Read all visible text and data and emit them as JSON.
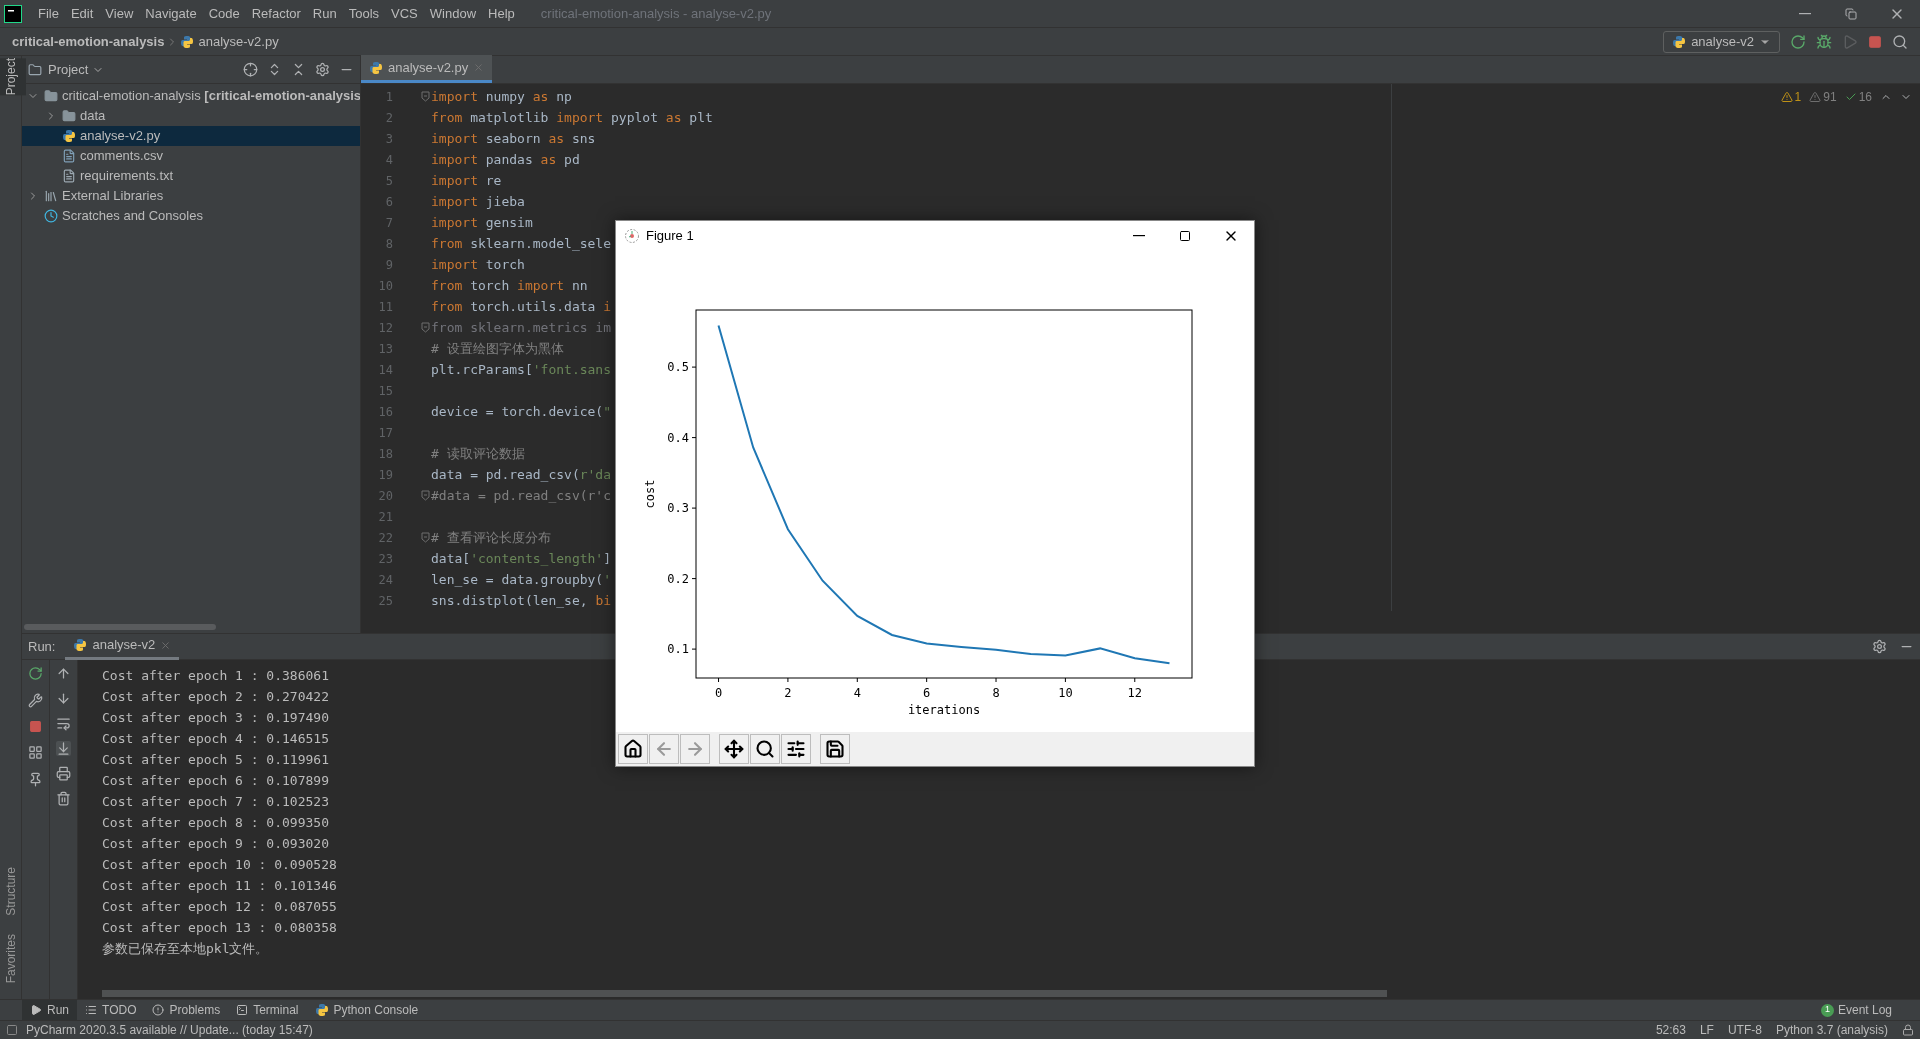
{
  "menu_bar": {
    "items": [
      "File",
      "Edit",
      "View",
      "Navigate",
      "Code",
      "Refactor",
      "Run",
      "Tools",
      "VCS",
      "Window",
      "Help"
    ],
    "title": "critical-emotion-analysis - analyse-v2.py"
  },
  "nav_bar": {
    "breadcrumbs": [
      "critical-emotion-analysis",
      "analyse-v2.py"
    ],
    "run_config": "analyse-v2"
  },
  "side_strip": {
    "top": [
      {
        "label": "Project",
        "selected": true
      }
    ],
    "bottom": [
      {
        "label": "Structure",
        "selected": false
      },
      {
        "label": "Favorites",
        "selected": false
      }
    ]
  },
  "project_panel": {
    "title": "Project",
    "tree": [
      {
        "label": "critical-emotion-analysis **[critical-emotion-analysis**",
        "kind": "folder",
        "expanded": true,
        "selected": false,
        "children": [
          {
            "label": "data",
            "kind": "folder",
            "expanded": false,
            "selected": false
          },
          {
            "label": "analyse-v2.py",
            "kind": "python",
            "selected": true
          },
          {
            "label": "comments.csv",
            "kind": "csv",
            "selected": false
          },
          {
            "label": "requirements.txt",
            "kind": "text",
            "selected": false
          }
        ]
      },
      {
        "label": "External Libraries",
        "kind": "library",
        "expanded": false,
        "selected": false
      },
      {
        "label": "Scratches and Consoles",
        "kind": "scratches",
        "selected": false
      }
    ]
  },
  "editor": {
    "tabs": [
      {
        "label": "analyse-v2.py",
        "selected": true
      }
    ],
    "inspections": [
      {
        "kind": "warning",
        "count": "1"
      },
      {
        "kind": "weak",
        "count": "91"
      },
      {
        "kind": "typo",
        "count": "16"
      }
    ],
    "lines": [
      {
        "number": "1",
        "fold": true,
        "tokens": [
          {
            "t": "import",
            "kind": "keyword"
          },
          {
            "t": " numpy ",
            "kind": "plain"
          },
          {
            "t": "as",
            "kind": "keyword"
          },
          {
            "t": " np",
            "kind": "plain"
          }
        ]
      },
      {
        "number": "2",
        "fold": false,
        "tokens": [
          {
            "t": "from",
            "kind": "keyword"
          },
          {
            "t": " matplotlib ",
            "kind": "plain"
          },
          {
            "t": "import",
            "kind": "keyword"
          },
          {
            "t": " pyplot ",
            "kind": "plain"
          },
          {
            "t": "as",
            "kind": "keyword"
          },
          {
            "t": " plt",
            "kind": "plain"
          }
        ]
      },
      {
        "number": "3",
        "fold": false,
        "tokens": [
          {
            "t": "import",
            "kind": "keyword"
          },
          {
            "t": " seaborn ",
            "kind": "plain"
          },
          {
            "t": "as",
            "kind": "keyword"
          },
          {
            "t": " sns",
            "kind": "plain"
          }
        ]
      },
      {
        "number": "4",
        "fold": false,
        "tokens": [
          {
            "t": "import",
            "kind": "keyword"
          },
          {
            "t": " pandas ",
            "kind": "plain"
          },
          {
            "t": "as",
            "kind": "keyword"
          },
          {
            "t": " pd",
            "kind": "plain"
          }
        ]
      },
      {
        "number": "5",
        "fold": false,
        "tokens": [
          {
            "t": "import",
            "kind": "keyword"
          },
          {
            "t": " re",
            "kind": "plain"
          }
        ]
      },
      {
        "number": "6",
        "fold": false,
        "tokens": [
          {
            "t": "import",
            "kind": "keyword"
          },
          {
            "t": " jieba",
            "kind": "plain"
          }
        ]
      },
      {
        "number": "7",
        "fold": false,
        "tokens": [
          {
            "t": "import",
            "kind": "keyword"
          },
          {
            "t": " gensim",
            "kind": "plain"
          }
        ]
      },
      {
        "number": "8",
        "fold": false,
        "tokens": [
          {
            "t": "from",
            "kind": "keyword"
          },
          {
            "t": " sklearn.model_sele",
            "kind": "plain"
          }
        ]
      },
      {
        "number": "9",
        "fold": false,
        "tokens": [
          {
            "t": "import",
            "kind": "keyword"
          },
          {
            "t": " torch",
            "kind": "plain"
          }
        ]
      },
      {
        "number": "10",
        "fold": false,
        "tokens": [
          {
            "t": "from",
            "kind": "keyword"
          },
          {
            "t": " torch ",
            "kind": "plain"
          },
          {
            "t": "import",
            "kind": "keyword"
          },
          {
            "t": " nn",
            "kind": "plain"
          }
        ]
      },
      {
        "number": "11",
        "fold": false,
        "tokens": [
          {
            "t": "from",
            "kind": "keyword"
          },
          {
            "t": " torch.utils.data ",
            "kind": "plain"
          },
          {
            "t": "i",
            "kind": "keyword"
          }
        ]
      },
      {
        "number": "12",
        "fold": true,
        "tokens": [
          {
            "t": "from sklearn.metrics im",
            "kind": "unused"
          }
        ]
      },
      {
        "number": "13",
        "fold": false,
        "tokens": [
          {
            "t": "# 设置绘图字体为黑体",
            "kind": "comment"
          }
        ]
      },
      {
        "number": "14",
        "fold": false,
        "tokens": [
          {
            "t": "plt.rcParams[",
            "kind": "plain"
          },
          {
            "t": "'font.sans",
            "kind": "string"
          }
        ]
      },
      {
        "number": "15",
        "fold": false
      },
      {
        "number": "16",
        "fold": false,
        "tokens": [
          {
            "t": "device = torch.device(",
            "kind": "plain"
          },
          {
            "t": "\"",
            "kind": "string"
          }
        ]
      },
      {
        "number": "17",
        "fold": false
      },
      {
        "number": "18",
        "fold": false,
        "tokens": [
          {
            "t": "# 读取评论数据",
            "kind": "comment"
          }
        ]
      },
      {
        "number": "19",
        "fold": false,
        "tokens": [
          {
            "t": "data = pd.read_csv(",
            "kind": "plain"
          },
          {
            "t": "r'da",
            "kind": "string"
          }
        ]
      },
      {
        "number": "20",
        "fold": true,
        "tokens": [
          {
            "t": "#data = pd.read_csv(r'c",
            "kind": "comment"
          }
        ]
      },
      {
        "number": "21",
        "fold": false
      },
      {
        "number": "22",
        "fold": true,
        "tokens": [
          {
            "t": "# 查看评论长度分布",
            "kind": "comment"
          }
        ]
      },
      {
        "number": "23",
        "fold": false,
        "tokens": [
          {
            "t": "data[",
            "kind": "plain"
          },
          {
            "t": "'contents_length'",
            "kind": "string"
          },
          {
            "t": "]",
            "kind": "plain"
          }
        ]
      },
      {
        "number": "24",
        "fold": false,
        "tokens": [
          {
            "t": "len_se = data.groupby(",
            "kind": "plain"
          },
          {
            "t": "'",
            "kind": "string"
          }
        ]
      },
      {
        "number": "25",
        "fold": false,
        "tokens": [
          {
            "t": "sns.distplot(len_se, ",
            "kind": "plain"
          },
          {
            "t": "bi",
            "kind": "keyword"
          }
        ]
      }
    ]
  },
  "figure_window": {
    "title": "Figure 1",
    "chart_data": {
      "type": "line",
      "xlabel": "iterations",
      "ylabel": "cost",
      "x": [
        0,
        1,
        2,
        3,
        4,
        5,
        6,
        7,
        8,
        9,
        10,
        11,
        12,
        13
      ],
      "series": [
        {
          "color": "#1f77b4",
          "values": [
            0.559,
            0.386,
            0.27,
            0.197,
            0.147,
            0.12,
            0.108,
            0.103,
            0.099,
            0.093,
            0.091,
            0.101,
            0.087,
            0.08
          ]
        }
      ],
      "xlim": [
        -0.65,
        13.65
      ],
      "ylim": [
        0.059,
        0.581
      ],
      "xticks": [
        0,
        2,
        4,
        6,
        8,
        10,
        12
      ],
      "yticks": [
        0.1,
        0.2,
        0.3,
        0.4,
        0.5
      ]
    },
    "toolbar": [
      {
        "kind": "home",
        "disabled": false
      },
      {
        "kind": "back",
        "disabled": true
      },
      {
        "kind": "forward",
        "disabled": true
      },
      {
        "kind": "pan",
        "disabled": false
      },
      {
        "kind": "zoom",
        "disabled": false
      },
      {
        "kind": "configure",
        "disabled": false
      },
      {
        "kind": "save",
        "disabled": false
      }
    ]
  },
  "run_panel": {
    "label": "Run:",
    "tabs": [
      {
        "label": "analyse-v2",
        "selected": true
      }
    ],
    "output": [
      "Cost after epoch 1 : 0.386061",
      "Cost after epoch 2 : 0.270422",
      "Cost after epoch 3 : 0.197490",
      "Cost after epoch 4 : 0.146515",
      "Cost after epoch 5 : 0.119961",
      "Cost after epoch 6 : 0.107899",
      "Cost after epoch 7 : 0.102523",
      "Cost after epoch 8 : 0.099350",
      "Cost after epoch 9 : 0.093020",
      "Cost after epoch 10 : 0.090528",
      "Cost after epoch 11 : 0.101346",
      "Cost after epoch 12 : 0.087055",
      "Cost after epoch 13 : 0.080358",
      "参数已保存至本地pkl文件。"
    ]
  },
  "tool_tabs": [
    {
      "kind": "run",
      "label": "Run",
      "selected": true
    },
    {
      "kind": "todo",
      "label": "TODO",
      "selected": false
    },
    {
      "kind": "problems",
      "label": "Problems",
      "selected": false
    },
    {
      "kind": "terminal",
      "label": "Terminal",
      "selected": false
    },
    {
      "kind": "python",
      "label": "Python Console",
      "selected": false
    }
  ],
  "event_log": {
    "badge": "1",
    "label": "Event Log"
  },
  "status_bar": {
    "message": "PyCharm 2020.3.5 available // Update... (today 15:47)",
    "items": [
      "52:63",
      "LF",
      "UTF-8",
      "Python 3.7 (analysis)"
    ]
  }
}
